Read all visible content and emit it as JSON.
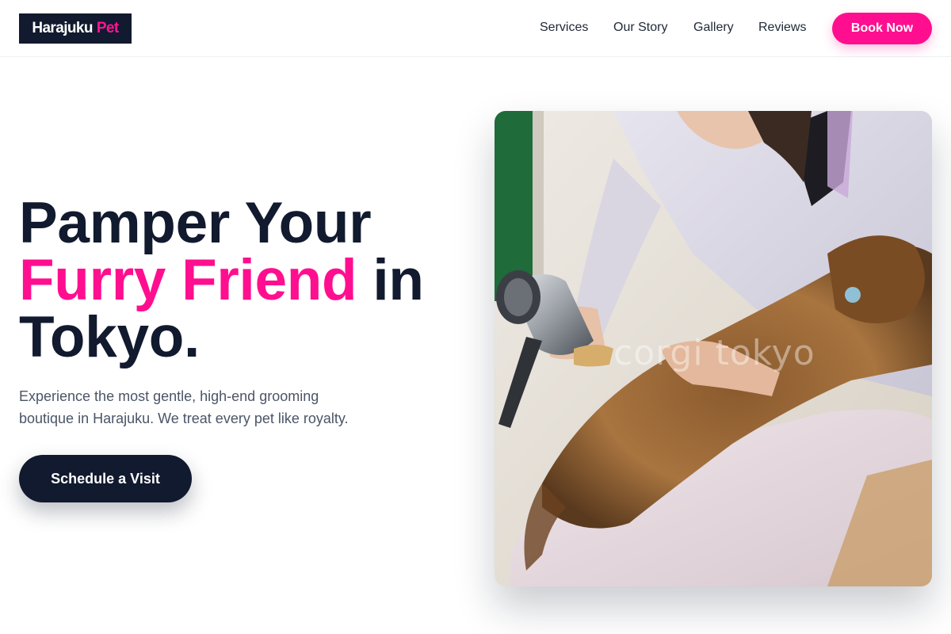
{
  "brand": {
    "name": "Harajuku",
    "accent_word": "Pet",
    "accent_color": "#ff0f8f",
    "dark_color": "#111a2e"
  },
  "nav": {
    "links": [
      {
        "label": "Services"
      },
      {
        "label": "Our Story"
      },
      {
        "label": "Gallery"
      },
      {
        "label": "Reviews"
      }
    ],
    "cta_label": "Book Now"
  },
  "hero": {
    "headline_line1": "Pamper Your",
    "headline_highlight": "Furry Friend",
    "headline_line2_rest": "in",
    "headline_line3": "Tokyo.",
    "subtext": "Experience the most gentle, high-end grooming boutique in Harajuku. We treat every pet like royalty.",
    "cta_label": "Schedule a Visit",
    "image": {
      "watermark": "corgi tokyo"
    }
  }
}
